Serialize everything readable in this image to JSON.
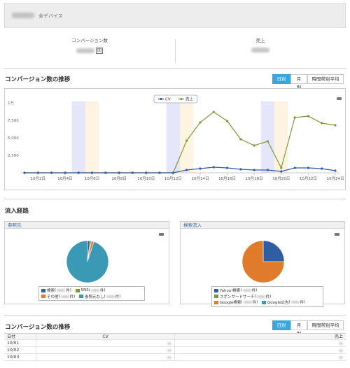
{
  "header": {
    "scope_label": "全デバイス"
  },
  "kpis": [
    {
      "title": "コンバージョン数",
      "unit": "回"
    },
    {
      "title": "売上"
    }
  ],
  "trend": {
    "title": "コンバージョン数の推移",
    "buttons": [
      "日別",
      "月別",
      "時間帯別平均"
    ]
  },
  "chart_data": {
    "type": "line",
    "legend": [
      "CV",
      "売上"
    ],
    "legend_position": "top-center",
    "y_ticks": [
      "1万",
      "7,500",
      "5,000",
      "2,500"
    ],
    "ylim": [
      0,
      10000
    ],
    "x_tick_labels": [
      "10月2日",
      "10月4日",
      "10月6日",
      "10月8日",
      "10月10日",
      "10月12日",
      "10月14日",
      "10月16日",
      "10月18日",
      "10月20日",
      "10月22日",
      "10月24日"
    ],
    "x": [
      1,
      2,
      3,
      4,
      5,
      6,
      7,
      8,
      9,
      10,
      11,
      12,
      13,
      14,
      15,
      16,
      17,
      18,
      19,
      20,
      21,
      22,
      23,
      24
    ],
    "series": [
      {
        "name": "CV",
        "color": "#2f5ea3",
        "values": [
          0,
          0,
          0,
          0,
          0,
          0,
          0,
          0,
          0,
          0,
          0,
          0,
          400,
          600,
          800,
          700,
          500,
          400,
          400,
          200,
          700,
          700,
          600,
          300
        ]
      },
      {
        "name": "売上",
        "color": "#7a9a3a",
        "values": [
          0,
          0,
          0,
          0,
          0,
          0,
          0,
          0,
          0,
          0,
          0,
          0,
          4600,
          7200,
          8700,
          7400,
          4800,
          3900,
          4500,
          700,
          7900,
          8100,
          7100,
          6800
        ]
      }
    ],
    "weekend_bands": [
      [
        5,
        6
      ],
      [
        12,
        13
      ],
      [
        19,
        20
      ]
    ],
    "weekend_colors": [
      "#e6e6fa",
      "#fff4e2"
    ],
    "grid": false
  },
  "sources": {
    "title": "流入経路",
    "referrer": {
      "title": "参照元",
      "legend": [
        {
          "label": "検索",
          "color": "#2f5ea3"
        },
        {
          "label": "SNS",
          "color": "#7a9a3a"
        },
        {
          "label": "その他",
          "color": "#e07b2c"
        },
        {
          "label": "参照元なし",
          "color": "#3a9ab5"
        }
      ],
      "pie_percent": [
        2,
        1,
        2,
        95
      ]
    },
    "search": {
      "title": "検索流入",
      "legend": [
        {
          "label": "Yahoo!検索",
          "color": "#2f5ea3"
        },
        {
          "label": "スポンサードサーチ",
          "color": "#7a9a3a"
        },
        {
          "label": "Google検索",
          "color": "#e07b2c"
        },
        {
          "label": "Google広告",
          "color": "#3a9ab5"
        }
      ],
      "pie_percent": [
        25,
        0,
        75,
        0
      ]
    },
    "count_unit": "件"
  },
  "table": {
    "title": "コンバージョン数の推移",
    "buttons": [
      "日別",
      "月別",
      "時間帯別平均"
    ],
    "headers": [
      "日付",
      "CV",
      "売上"
    ],
    "rows": [
      "10/01",
      "10/02",
      "10/03"
    ]
  }
}
